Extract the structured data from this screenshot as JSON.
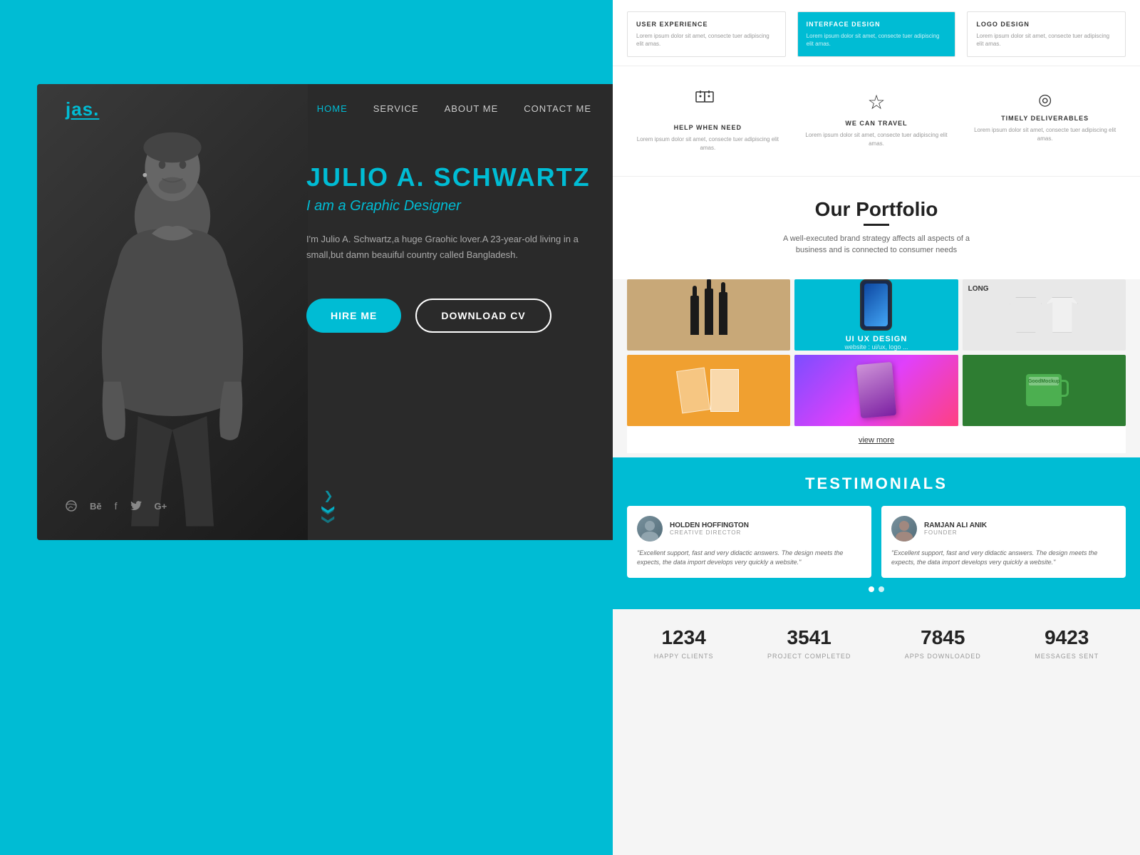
{
  "brand": {
    "logo": "jas.",
    "accent_color": "#00bcd4"
  },
  "nav": {
    "items": [
      {
        "label": "HOME",
        "active": true
      },
      {
        "label": "SERVICE",
        "active": false
      },
      {
        "label": "ABOUT ME",
        "active": false
      },
      {
        "label": "CONTACT ME",
        "active": false
      }
    ]
  },
  "hero": {
    "name": "JULIO A. SCHWARTZ",
    "subtitle": "I am a Graphic Designer",
    "description": "I'm Julio A. Schwartz,a huge Graohic lover.A 23-year-old living in a small,but damn beauiful country called Bangladesh.",
    "hire_btn": "HIRE ME",
    "cv_btn": "DOWNLOAD CV"
  },
  "social": {
    "items": [
      "⊕",
      "Bē",
      "f",
      "🐦",
      "G+"
    ]
  },
  "services_top": [
    {
      "title": "USER EXPERIENCE",
      "text": "Lorem ipsum dolor sit amet, consecte tuer adipiscing elit amas.",
      "highlight": false
    },
    {
      "title": "INTERFACE DESIGN",
      "text": "Lorem ipsum dolor sit amet, consecte tuer adipiscing elit amas.",
      "highlight": true
    },
    {
      "title": "LOGO DESIGN",
      "text": "Lorem ipsum dolor sit amet, consecte tuer adipiscing elit amas.",
      "highlight": false
    }
  ],
  "services_icons": [
    {
      "icon": "⚙",
      "title": "HELP WHEN NEED",
      "desc": "Lorem ipsum dolor sit amet, consecte tuer adipiscing elit amas."
    },
    {
      "icon": "☆",
      "title": "WE CAN TRAVEL",
      "desc": "Lorem ipsum dolor sit amet, consecte tuer adipiscing elit amas."
    },
    {
      "icon": "◎",
      "title": "TIMELY DELIVERABLES",
      "desc": "Lorem ipsum dolor sit amet, consecte tuer adipiscing elit amas."
    }
  ],
  "portfolio": {
    "title": "Our Portfolio",
    "description": "A well-executed brand strategy affects all aspects of a business and is connected to consumer needs",
    "view_more": "view more",
    "items": [
      {
        "type": "bottles",
        "label": ""
      },
      {
        "type": "ui_ux",
        "label": "UI UX DESIGN",
        "sublabel": "website : ui/ux, logo ..."
      },
      {
        "type": "shirts",
        "label": "LONG"
      },
      {
        "type": "brochure",
        "label": ""
      },
      {
        "type": "gradient",
        "label": ""
      },
      {
        "type": "mug",
        "label": ""
      }
    ]
  },
  "testimonials": {
    "title": "TESTIMONIALS",
    "items": [
      {
        "name": "HOLDEN HOFFINGTON",
        "role": "CREATIVE DIRECTOR",
        "text": "\"Excellent support, fast and very didactic answers. The design meets the expects, the data import develops very quickly a website.\""
      },
      {
        "name": "RAMJAN ALI ANIK",
        "role": "FOUNDER",
        "text": "\"Excellent support, fast and very didactic answers. The design meets the expects, the data import develops very quickly a website.\""
      }
    ]
  },
  "stats": [
    {
      "number": "1234",
      "label": "HAPPY CLIENTS"
    },
    {
      "number": "3541",
      "label": "PROJECT COMPLETED"
    },
    {
      "number": "7845",
      "label": "APPS DOWNLOADED"
    },
    {
      "number": "9423",
      "label": "MESSAGES SENT"
    }
  ]
}
